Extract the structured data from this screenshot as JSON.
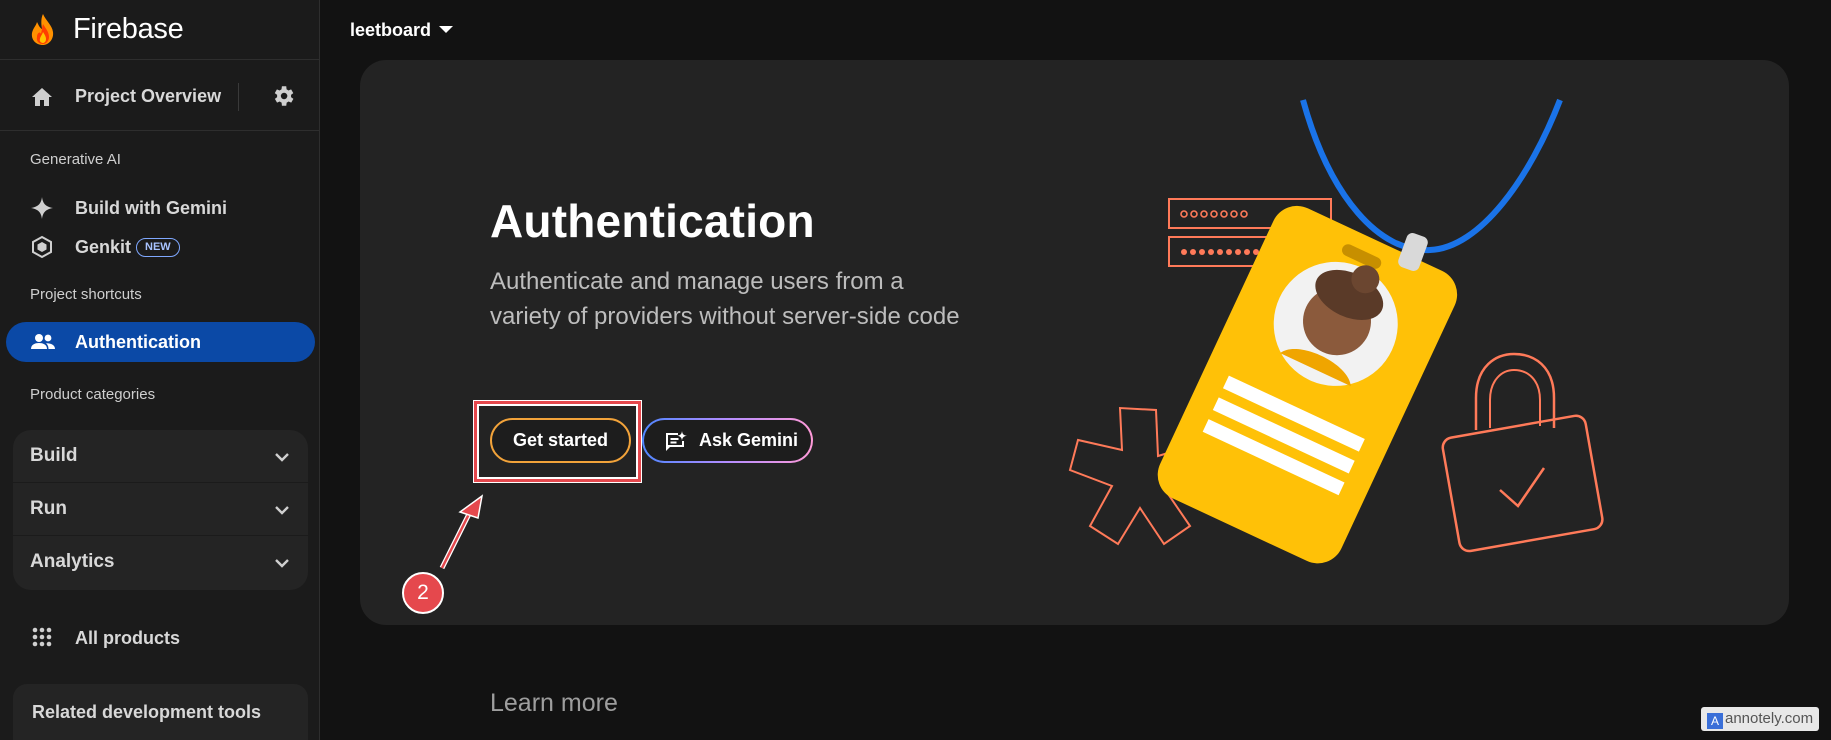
{
  "brand": {
    "name": "Firebase"
  },
  "sidebar": {
    "overview_label": "Project Overview",
    "section_generative": "Generative AI",
    "build_with_gemini": "Build with Gemini",
    "genkit": "Genkit",
    "genkit_badge": "NEW",
    "section_shortcuts": "Project shortcuts",
    "active_item": "Authentication",
    "section_categories": "Product categories",
    "categories": [
      {
        "label": "Build"
      },
      {
        "label": "Run"
      },
      {
        "label": "Analytics"
      }
    ],
    "all_products": "All products",
    "related_tools": "Related development tools"
  },
  "header": {
    "project_name": "leetboard"
  },
  "hero": {
    "title": "Authentication",
    "description": "Authenticate and manage users from a variety of providers without server-side code",
    "get_started_label": "Get started",
    "ask_gemini_label": "Ask Gemini"
  },
  "annotation": {
    "step_number": "2"
  },
  "main": {
    "learn_more": "Learn more"
  },
  "watermark": {
    "icon_letter": "A",
    "text": "annotely.com"
  },
  "colors": {
    "accent_blue": "#0b49a6",
    "get_started_border": "#f2a33a",
    "annotation_red": "#e5484d",
    "card_yellow": "#ffc107",
    "illustration_orange": "#ff7a59"
  }
}
